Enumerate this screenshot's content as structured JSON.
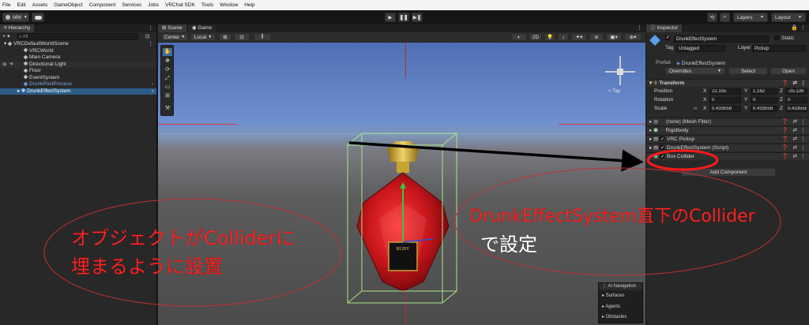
{
  "menu": [
    "File",
    "Edit",
    "Assets",
    "GameObject",
    "Component",
    "Services",
    "Jobs",
    "VRChat SDK",
    "Tools",
    "Window",
    "Help"
  ],
  "toolbar": {
    "account": "MM",
    "layers": "Layers",
    "layout": "Layout"
  },
  "hierarchy": {
    "tab": "Hierarchy",
    "search_placeholder": "All",
    "scene": "VRCDefaultWorldScene",
    "items": [
      "VRCWorld",
      "Main Camera",
      "Directional Light",
      "Floor",
      "EventSystem",
      "DrunkPostProcess",
      "DrunkEffectSystem"
    ]
  },
  "scene": {
    "tabs": [
      "Scene",
      "Game"
    ],
    "pivot": "Center",
    "space": "Local",
    "mode": "2D",
    "gizmo_label": "< Top",
    "ai_nav": {
      "title": "AI Navigation",
      "items": [
        "Surfaces",
        "Agents",
        "Obstacles"
      ]
    }
  },
  "inspector": {
    "tab": "Inspector",
    "object_name": "DrunkEffectSystem",
    "static": "Static",
    "tag_label": "Tag",
    "tag_value": "Untagged",
    "layer_label": "Layer",
    "layer_value": "Pickup",
    "prefab_label": "Prefab",
    "prefab_value": "DrunkEffectSystem",
    "overrides": "Overrides",
    "select": "Select",
    "open": "Open",
    "transform": "Transform",
    "position_label": "Position",
    "rotation_label": "Rotation",
    "scale_label": "Scale",
    "pos": {
      "x": "22.155",
      "y": "1.162",
      "z": "-25.139"
    },
    "rot": {
      "x": "0",
      "y": "0",
      "z": "0"
    },
    "scl": {
      "x": "0.433558",
      "y": "0.433558",
      "z": "0.433558"
    },
    "components": [
      "(none) (Mesh Filter)",
      "Rigidbody",
      "VRC Pickup",
      "DrunkEffectSystem (Script)",
      "Box Collider"
    ],
    "add_component": "Add Component"
  },
  "annotations": {
    "left_line1": "オブジェクトがColliderに",
    "left_line2": "埋まるように設置",
    "right_line1": "DrunkEffectSystem直下のCollider",
    "right_line2": "で設定"
  },
  "colors": {
    "annotation_red": "#ff2a2a",
    "selection_blue": "#2c5d87",
    "bottle_red": "#c8161c"
  }
}
